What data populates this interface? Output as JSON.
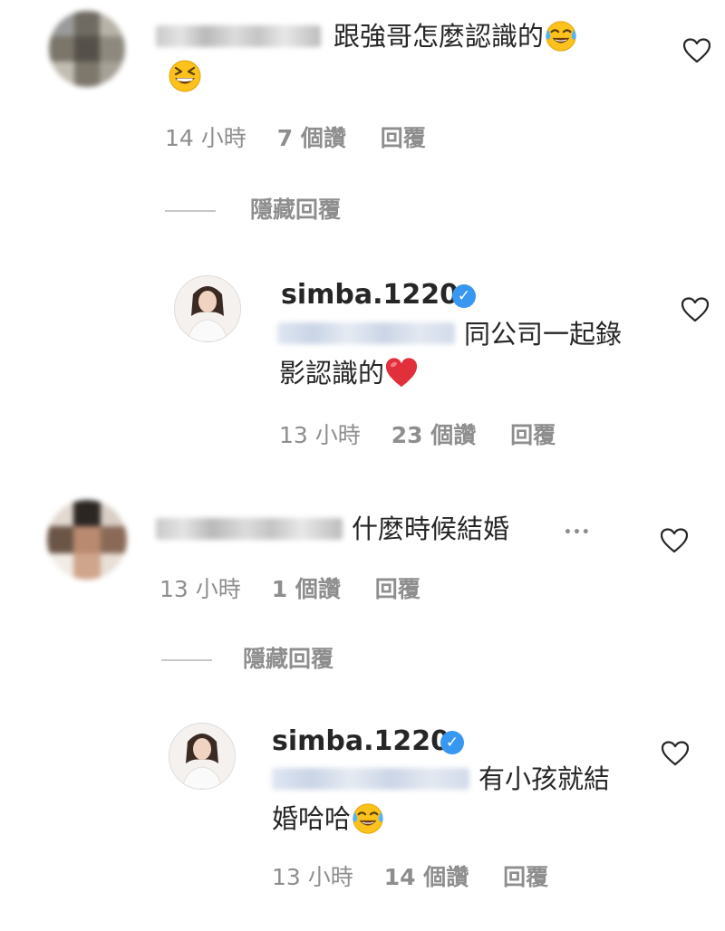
{
  "comments": [
    {
      "text_line1": "跟強哥怎麼認識的",
      "time": "14 小時",
      "likes": "7 個讚",
      "reply": "回覆",
      "hide_replies": "隱藏回覆",
      "reply_item": {
        "username": "simba.1220",
        "text_line1": "同公司一起錄",
        "text_line2": "影認識的",
        "time": "13 小時",
        "likes": "23 個讚",
        "reply": "回覆"
      }
    },
    {
      "text_line1": "什麼時候結婚",
      "more": "•••",
      "time": "13 小時",
      "likes": "1 個讚",
      "reply": "回覆",
      "hide_replies": "隱藏回覆",
      "reply_item": {
        "username": "simba.1220",
        "text_line1": "有小孩就結",
        "text_line2": "婚哈哈",
        "time": "13 小時",
        "likes": "14 個讚",
        "reply": "回覆"
      }
    }
  ],
  "icons": {
    "heart": "heart-outline-icon",
    "verified": "verified-badge-icon",
    "laugh_tears": "face-with-tears-of-joy-emoji",
    "grin_squint": "grinning-squinting-face-emoji",
    "red_heart": "red-heart-emoji"
  },
  "colors": {
    "text": "#262626",
    "meta": "#8e8e8e",
    "verified": "#3897f0",
    "divider": "#c7c7c7"
  }
}
